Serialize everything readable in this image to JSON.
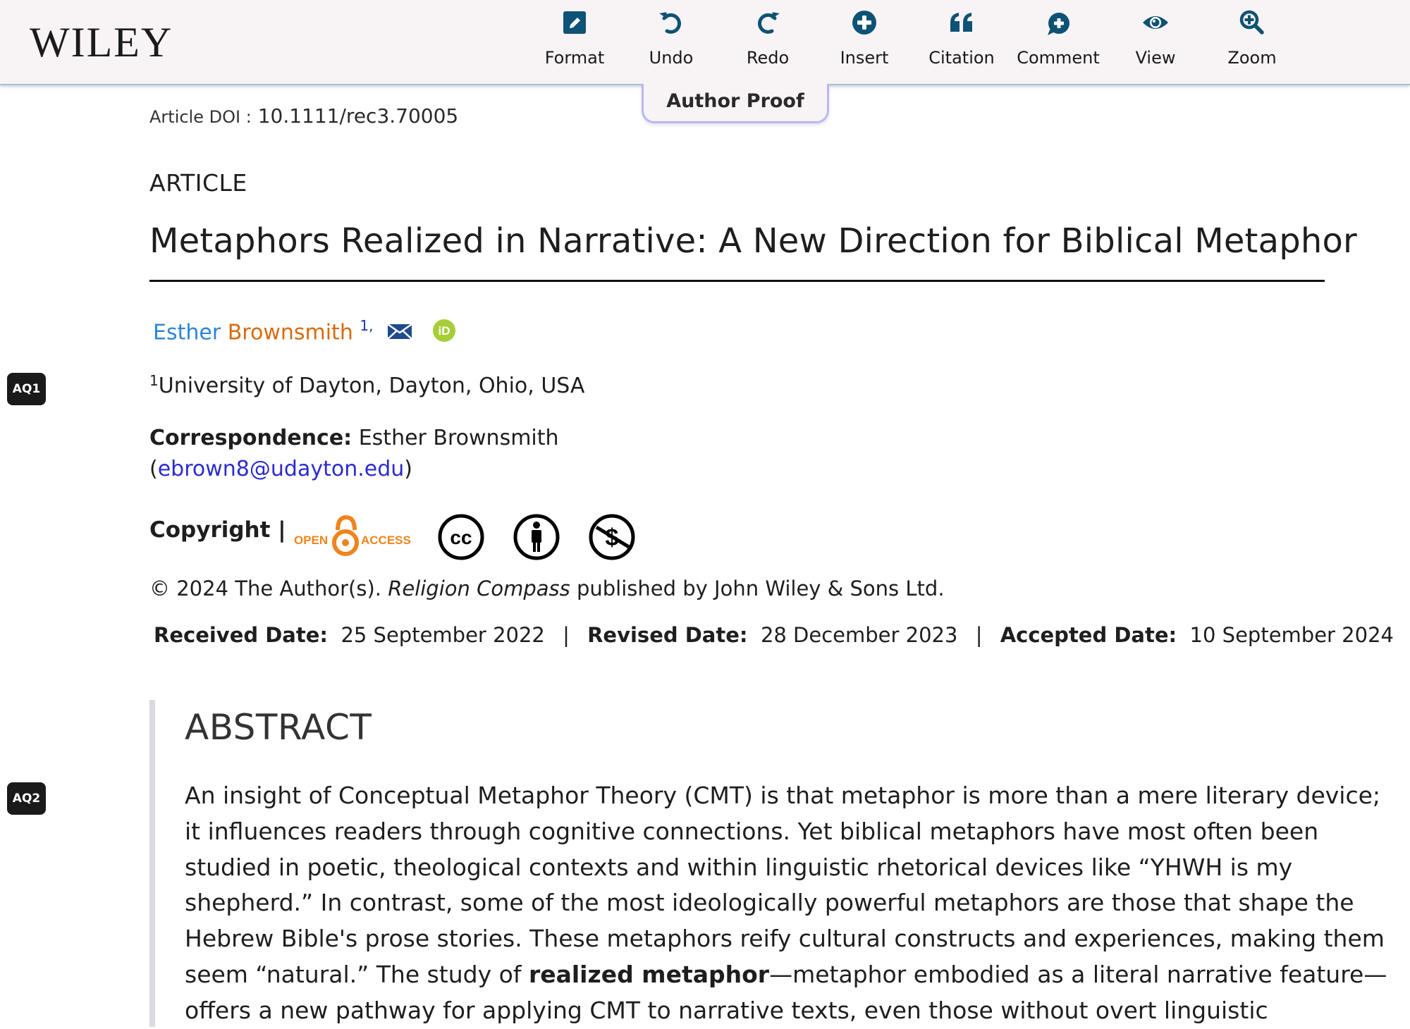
{
  "header": {
    "logo": "WILEY",
    "tools": [
      {
        "id": "format",
        "label": "Format",
        "icon": "edit-icon"
      },
      {
        "id": "undo",
        "label": "Undo",
        "icon": "undo-icon"
      },
      {
        "id": "redo",
        "label": "Redo",
        "icon": "redo-icon"
      },
      {
        "id": "insert",
        "label": "Insert",
        "icon": "plus-circle-icon"
      },
      {
        "id": "citation",
        "label": "Citation",
        "icon": "quote-icon"
      },
      {
        "id": "comment",
        "label": "Comment",
        "icon": "comment-plus-icon"
      },
      {
        "id": "view",
        "label": "View",
        "icon": "eye-icon"
      },
      {
        "id": "zoom",
        "label": "Zoom",
        "icon": "zoom-in-icon"
      }
    ],
    "icon_color": "#0e5275",
    "proof_tab": "Author Proof"
  },
  "article": {
    "doi_label": "Article DOI :",
    "doi": "10.1111/rec3.70005",
    "type": "ARTICLE",
    "title": "Metaphors Realized in Narrative: A New Direction for Biblical Metaphor",
    "author": {
      "given": "Esther",
      "family": "Brownsmith",
      "sup": "1,"
    },
    "affiliation": {
      "sup": "1",
      "text": "University of Dayton, Dayton, Ohio, USA"
    },
    "correspondence": {
      "label": "Correspondence:",
      "name": "Esther Brownsmith",
      "open_paren": "(",
      "email": "ebrown8@udayton.edu",
      "close_paren": ")"
    },
    "copyright": {
      "label": "Copyright |",
      "open_access_left": "OPEN",
      "open_access_right": "ACCESS",
      "license_icons": [
        "cc-icon",
        "by-attribution-icon",
        "noncommercial-icon"
      ],
      "line_prefix": "© 2024 The Author(s). ",
      "journal": "Religion Compass",
      "line_suffix": " published by John Wiley & Sons Ltd."
    },
    "dates": [
      {
        "label": "Received Date:",
        "value": "25 September 2022"
      },
      {
        "label": "Revised Date:",
        "value": "28 December 2023"
      },
      {
        "label": "Accepted Date:",
        "value": "10 September 2024"
      }
    ],
    "date_separator": "|"
  },
  "queries": [
    {
      "label": "AQ1"
    },
    {
      "label": "AQ2"
    }
  ],
  "abstract": {
    "heading": "ABSTRACT",
    "lines": [
      {
        "text": "An insight of Conceptual Metaphor Theory (CMT) is that metaphor is more than a mere literary device;"
      },
      {
        "text": "it influences readers through cognitive connections. Yet biblical metaphors have most often been"
      },
      {
        "text": "studied in poetic, theological contexts and within linguistic rhetorical devices like “YHWH is my"
      },
      {
        "text": "shepherd.” In contrast, some of the most ideologically powerful metaphors are those that shape the"
      },
      {
        "text": "Hebrew Bible's prose stories. These metaphors reify cultural constructs and experiences, making them"
      },
      {
        "pre": "seem “natural.” The study of ",
        "bold": "realized metaphor",
        "post": "—metaphor embodied as a literal narrative feature—"
      },
      {
        "text": "offers a new pathway for applying CMT to narrative texts, even those without overt linguistic"
      }
    ]
  },
  "colors": {
    "author_given": "#2c86d8",
    "author_family": "#d96b10",
    "email_link": "#2c2ccf",
    "open_access": "#f0841c",
    "orcid": "#a6ce39"
  }
}
